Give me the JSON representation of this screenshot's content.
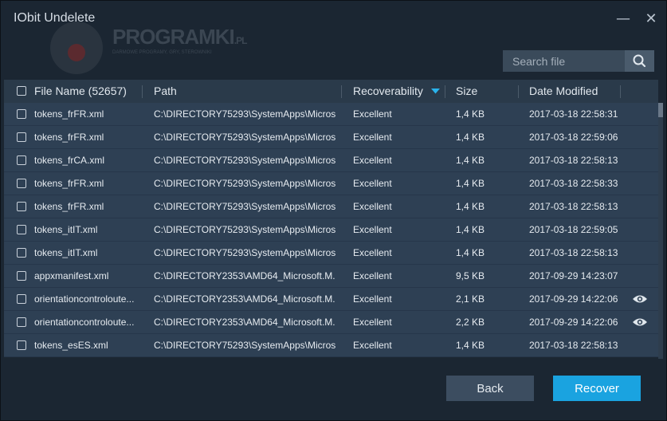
{
  "window": {
    "title": "IObit Undelete",
    "minimize_glyph": "—",
    "close_glyph": "✕"
  },
  "watermark": {
    "text": "PROGRAMKI",
    "suffix": ".PL",
    "subtitle": "DARMOWE PROGRAMY, GRY, STEROWNIKI"
  },
  "search": {
    "placeholder": "Search file",
    "icon": "search-icon"
  },
  "table": {
    "columns": {
      "name": "File Name (52657)",
      "path": "Path",
      "recoverability": "Recoverability",
      "size": "Size",
      "date": "Date Modified"
    },
    "sort_icon": "sort-down-icon",
    "rows": [
      {
        "name": "tokens_frFR.xml",
        "path": "C:\\DIRECTORY75293\\SystemApps\\Micros...",
        "recoverability": "Excellent",
        "size": "1,4 KB",
        "date": "2017-03-18 22:58:31",
        "preview": false
      },
      {
        "name": "tokens_frFR.xml",
        "path": "C:\\DIRECTORY75293\\SystemApps\\Micros...",
        "recoverability": "Excellent",
        "size": "1,4 KB",
        "date": "2017-03-18 22:59:06",
        "preview": false
      },
      {
        "name": "tokens_frCA.xml",
        "path": "C:\\DIRECTORY75293\\SystemApps\\Micros...",
        "recoverability": "Excellent",
        "size": "1,4 KB",
        "date": "2017-03-18 22:58:13",
        "preview": false
      },
      {
        "name": "tokens_frFR.xml",
        "path": "C:\\DIRECTORY75293\\SystemApps\\Micros...",
        "recoverability": "Excellent",
        "size": "1,4 KB",
        "date": "2017-03-18 22:58:33",
        "preview": false
      },
      {
        "name": "tokens_frFR.xml",
        "path": "C:\\DIRECTORY75293\\SystemApps\\Micros...",
        "recoverability": "Excellent",
        "size": "1,4 KB",
        "date": "2017-03-18 22:58:13",
        "preview": false
      },
      {
        "name": "tokens_itIT.xml",
        "path": "C:\\DIRECTORY75293\\SystemApps\\Micros...",
        "recoverability": "Excellent",
        "size": "1,4 KB",
        "date": "2017-03-18 22:59:05",
        "preview": false
      },
      {
        "name": "tokens_itIT.xml",
        "path": "C:\\DIRECTORY75293\\SystemApps\\Micros...",
        "recoverability": "Excellent",
        "size": "1,4 KB",
        "date": "2017-03-18 22:58:13",
        "preview": false
      },
      {
        "name": "appxmanifest.xml",
        "path": "C:\\DIRECTORY2353\\AMD64_Microsoft.M...",
        "recoverability": "Excellent",
        "size": "9,5 KB",
        "date": "2017-09-29 14:23:07",
        "preview": false
      },
      {
        "name": "orientationcontroloute...",
        "path": "C:\\DIRECTORY2353\\AMD64_Microsoft.M...",
        "recoverability": "Excellent",
        "size": "2,1 KB",
        "date": "2017-09-29 14:22:06",
        "preview": true
      },
      {
        "name": "orientationcontroloute...",
        "path": "C:\\DIRECTORY2353\\AMD64_Microsoft.M...",
        "recoverability": "Excellent",
        "size": "2,2 KB",
        "date": "2017-09-29 14:22:06",
        "preview": true
      },
      {
        "name": "tokens_esES.xml",
        "path": "C:\\DIRECTORY75293\\SystemApps\\Micros...",
        "recoverability": "Excellent",
        "size": "1,4 KB",
        "date": "2017-03-18 22:58:13",
        "preview": false
      }
    ]
  },
  "footer": {
    "back_label": "Back",
    "recover_label": "Recover"
  },
  "colors": {
    "accent": "#1aa3e0",
    "background": "#1b2632",
    "row": "#2e4054",
    "header": "#2a3a4a"
  }
}
